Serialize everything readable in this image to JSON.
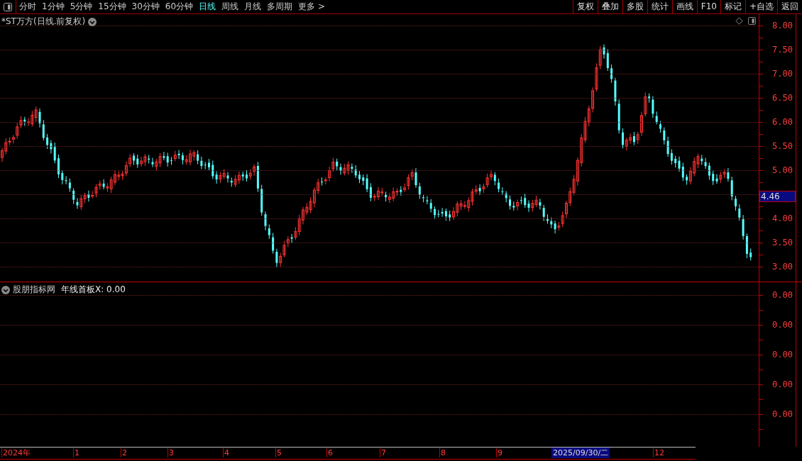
{
  "toolbar": {
    "periods": [
      {
        "label": "分时",
        "selected": false
      },
      {
        "label": "1分钟",
        "selected": false
      },
      {
        "label": "5分钟",
        "selected": false
      },
      {
        "label": "15分钟",
        "selected": false
      },
      {
        "label": "30分钟",
        "selected": false
      },
      {
        "label": "60分钟",
        "selected": false
      },
      {
        "label": "日线",
        "selected": true
      },
      {
        "label": "周线",
        "selected": false
      },
      {
        "label": "月线",
        "selected": false
      },
      {
        "label": "多周期",
        "selected": false
      },
      {
        "label": "更多 >",
        "selected": false
      }
    ],
    "actions": [
      "复权",
      "叠加",
      "多股",
      "统计",
      "画线",
      "F10",
      "标记",
      "+自选",
      "返回"
    ]
  },
  "main_chart": {
    "title": "*ST万方(日线.前复权)",
    "price_ticks": [
      "8.00",
      "7.50",
      "7.00",
      "6.50",
      "6.00",
      "5.50",
      "5.00",
      "4.00",
      "3.50",
      "3.00"
    ],
    "current_price": "4.46"
  },
  "indicator": {
    "source": "股朋指标网",
    "label": "年线首板X: 0.00",
    "ticks": [
      "0.00",
      "0.00",
      "0.00",
      "0.00",
      "0.00"
    ]
  },
  "time_axis": {
    "labels": [
      "2024年",
      "1",
      "2",
      "3",
      "4",
      "5",
      "6",
      "7",
      "8",
      "9",
      "12"
    ],
    "cursor_date": "2025/09/30/二"
  }
}
